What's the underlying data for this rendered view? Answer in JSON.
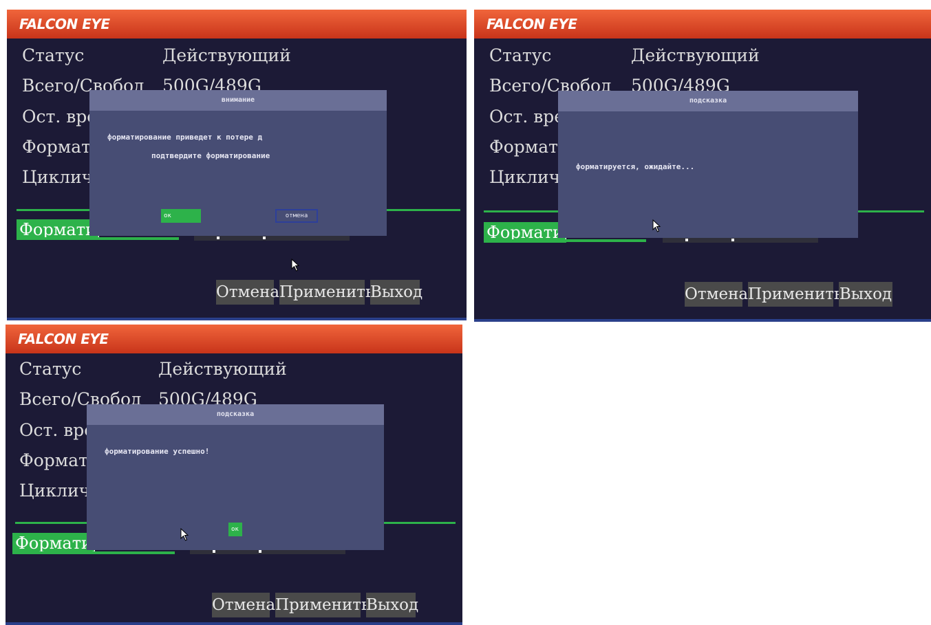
{
  "panels": [
    {
      "brand": "FALCON EYE",
      "fields": [
        {
          "label": "Статус",
          "value": "Действующий"
        },
        {
          "label": "Всего/Свобод",
          "value": "500G/489G"
        },
        {
          "label": "Ост. вре",
          "value": ""
        },
        {
          "label": "Формати",
          "value": ""
        },
        {
          "label": "Цикличн",
          "value": ""
        }
      ],
      "format_tab": "Форматир",
      "buttons": {
        "cancel": "Отмена",
        "apply": "Применить",
        "exit": "Выход"
      },
      "dialog": {
        "title": "внимание",
        "lines": [
          "форматирование  приведет к потере д",
          "подтвердите форматирование"
        ],
        "ok": "ок",
        "cancel": "отмена"
      }
    },
    {
      "brand": "FALCON EYE",
      "fields": [
        {
          "label": "Статус",
          "value": "Действующий"
        },
        {
          "label": "Всего/Свобод",
          "value": "500G/489G"
        },
        {
          "label": "Ост. вре",
          "value": ""
        },
        {
          "label": "Формати",
          "value": ""
        },
        {
          "label": "Цикличн",
          "value": ""
        }
      ],
      "format_tab": "Форматир",
      "buttons": {
        "cancel": "Отмена",
        "apply": "Применить",
        "exit": "Выход"
      },
      "dialog": {
        "title": "подсказка",
        "lines": [
          "форматируется, ожидайте..."
        ]
      }
    },
    {
      "brand": "FALCON EYE",
      "fields": [
        {
          "label": "Статус",
          "value": "Действующий"
        },
        {
          "label": "Всего/Свобод",
          "value": "500G/489G"
        },
        {
          "label": "Ост. вре",
          "value": ""
        },
        {
          "label": "Формати",
          "value": ""
        },
        {
          "label": "Цикличн",
          "value": ""
        }
      ],
      "format_tab": "Форматир",
      "buttons": {
        "cancel": "Отмена",
        "apply": "Применить",
        "exit": "Выход"
      },
      "dialog": {
        "title": "подсказка",
        "lines": [
          "форматирование успешно!"
        ],
        "ok": "ок"
      }
    }
  ]
}
